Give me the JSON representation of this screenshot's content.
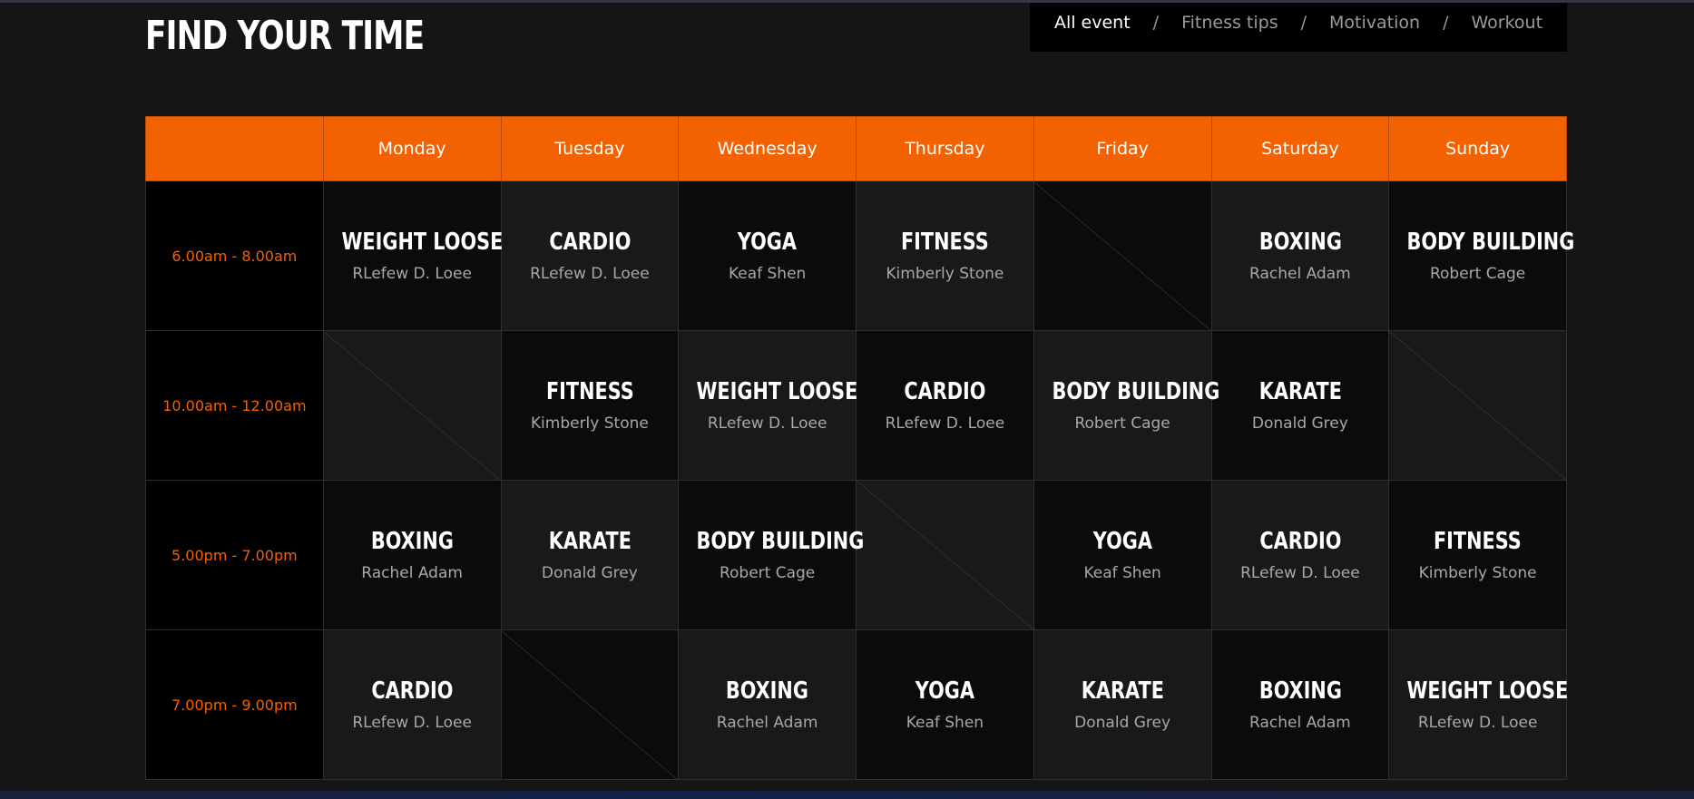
{
  "page": {
    "title": "FIND YOUR TIME"
  },
  "filters": [
    {
      "label": "All event",
      "active": true
    },
    {
      "label": "Fitness tips",
      "active": false
    },
    {
      "label": "Motivation",
      "active": false
    },
    {
      "label": "Workout",
      "active": false
    }
  ],
  "filter_separator": "/",
  "schedule": {
    "days": [
      "Monday",
      "Tuesday",
      "Wednesday",
      "Thursday",
      "Friday",
      "Saturday",
      "Sunday"
    ],
    "rows": [
      {
        "time": "6.00am - 8.00am",
        "slots": [
          {
            "class": "WEIGHT LOOSE",
            "trainer": "RLefew D. Loee"
          },
          {
            "class": "CARDIO",
            "trainer": "RLefew D. Loee"
          },
          {
            "class": "YOGA",
            "trainer": "Keaf Shen"
          },
          {
            "class": "FITNESS",
            "trainer": "Kimberly Stone"
          },
          null,
          {
            "class": "BOXING",
            "trainer": "Rachel Adam"
          },
          {
            "class": "BODY BUILDING",
            "trainer": "Robert Cage"
          }
        ]
      },
      {
        "time": "10.00am - 12.00am",
        "slots": [
          null,
          {
            "class": "FITNESS",
            "trainer": "Kimberly Stone"
          },
          {
            "class": "WEIGHT LOOSE",
            "trainer": "RLefew D. Loee"
          },
          {
            "class": "CARDIO",
            "trainer": "RLefew D. Loee"
          },
          {
            "class": "BODY BUILDING",
            "trainer": "Robert Cage"
          },
          {
            "class": "KARATE",
            "trainer": "Donald Grey"
          },
          null
        ]
      },
      {
        "time": "5.00pm - 7.00pm",
        "slots": [
          {
            "class": "BOXING",
            "trainer": "Rachel Adam"
          },
          {
            "class": "KARATE",
            "trainer": "Donald Grey"
          },
          {
            "class": "BODY BUILDING",
            "trainer": "Robert Cage"
          },
          null,
          {
            "class": "YOGA",
            "trainer": "Keaf Shen"
          },
          {
            "class": "CARDIO",
            "trainer": "RLefew D. Loee"
          },
          {
            "class": "FITNESS",
            "trainer": "Kimberly Stone"
          }
        ]
      },
      {
        "time": "7.00pm - 9.00pm",
        "slots": [
          {
            "class": "CARDIO",
            "trainer": "RLefew D. Loee"
          },
          null,
          {
            "class": "BOXING",
            "trainer": "Rachel Adam"
          },
          {
            "class": "YOGA",
            "trainer": "Keaf Shen"
          },
          {
            "class": "KARATE",
            "trainer": "Donald Grey"
          },
          {
            "class": "BOXING",
            "trainer": "Rachel Adam"
          },
          {
            "class": "WEIGHT LOOSE",
            "trainer": "RLefew D. Loee"
          }
        ]
      }
    ]
  },
  "colors": {
    "accent": "#f36100",
    "background": "#151515",
    "cell_dark": "#0b0b0b",
    "cell_light": "#191919"
  }
}
